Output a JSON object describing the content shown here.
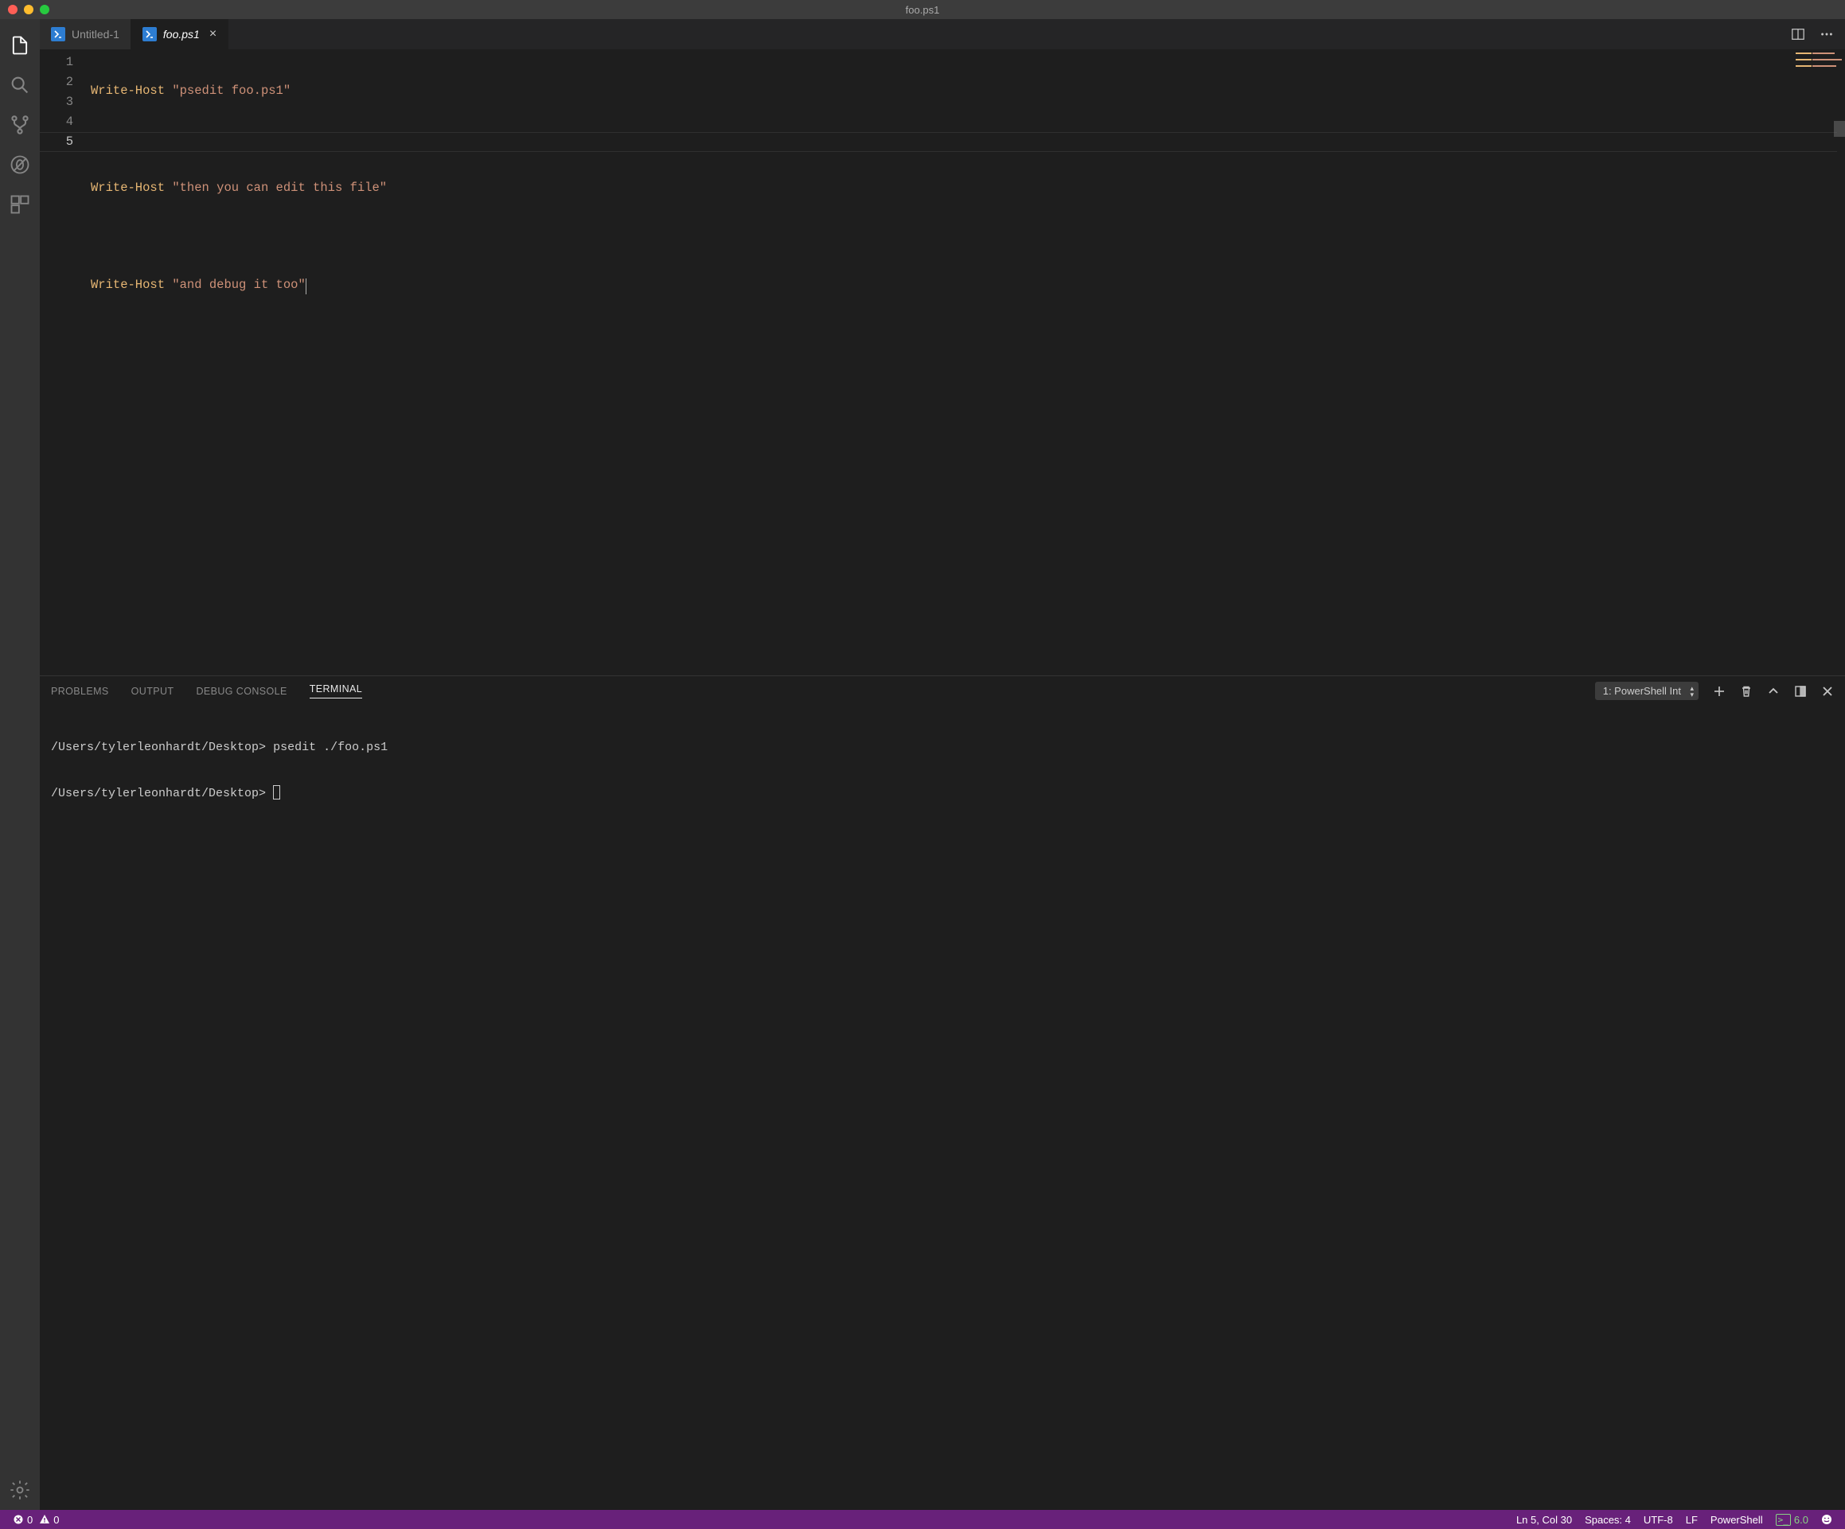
{
  "window": {
    "title": "foo.ps1"
  },
  "tabs": [
    {
      "label": "Untitled-1",
      "active": false,
      "closeable": false
    },
    {
      "label": "foo.ps1",
      "active": true,
      "closeable": true
    }
  ],
  "editor": {
    "line_numbers": [
      "1",
      "2",
      "3",
      "4",
      "5"
    ],
    "current_line_index": 4,
    "lines": [
      {
        "cmd": "Write-Host",
        "str": "\"psedit foo.ps1\""
      },
      {
        "blank": true
      },
      {
        "cmd": "Write-Host",
        "str": "\"then you can edit this file\""
      },
      {
        "blank": true
      },
      {
        "cmd": "Write-Host",
        "str": "\"and debug it too\"",
        "cursor_after": true
      }
    ]
  },
  "panel": {
    "tabs": [
      "PROBLEMS",
      "OUTPUT",
      "DEBUG CONSOLE",
      "TERMINAL"
    ],
    "active_tab": "TERMINAL",
    "terminal_selector": "1: PowerShell Int",
    "terminal_lines": [
      {
        "prompt": "/Users/tylerleonhardt/Desktop>",
        "cmd": "psedit ./foo.ps1"
      },
      {
        "prompt": "/Users/tylerleonhardt/Desktop>",
        "cmd": "",
        "cursor": true
      }
    ]
  },
  "statusbar": {
    "errors": "0",
    "warnings": "0",
    "cursor_pos": "Ln 5, Col 30",
    "indent": "Spaces: 4",
    "encoding": "UTF-8",
    "eol": "LF",
    "language": "PowerShell",
    "ps_version": "6.0"
  }
}
